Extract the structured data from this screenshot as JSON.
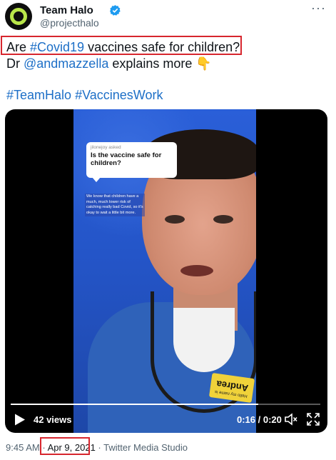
{
  "account": {
    "display_name": "Team Halo",
    "handle": "@projecthalo",
    "verified": true,
    "avatar_colors": {
      "bg": "#0d0d0d",
      "ring": "#b9e64a"
    }
  },
  "more_menu": "···",
  "tweet": {
    "line1": {
      "pre": "Are ",
      "hashtag": "#Covid19",
      "post": " vaccines safe for children?"
    },
    "line2": {
      "pre": "Dr ",
      "mention": "@andmazzella",
      "post": " explains more ",
      "emoji": "👇"
    },
    "line3": {
      "tag1": "#TeamHalo",
      "tag2": "#VaccinesWork"
    },
    "link_color": "#1d6fc7",
    "highlight_color": "#d7262e"
  },
  "video": {
    "question_asker": "jilonejoy asked",
    "question_text": "Is the vaccine safe for children?",
    "answer_caption": "We know that children have a much, much lower risk of catching really bad Covid, so it's okay to wait a little bit more.",
    "badge_hello": "Hello my name is",
    "badge_name": "Andrea",
    "views": "42 views",
    "time": "0:16 / 0:20",
    "progress_fraction": 0.8
  },
  "footer": {
    "time": "9:45 AM",
    "separator": "·",
    "date": "Apr 9, 2021",
    "source": "Twitter Media Studio"
  }
}
